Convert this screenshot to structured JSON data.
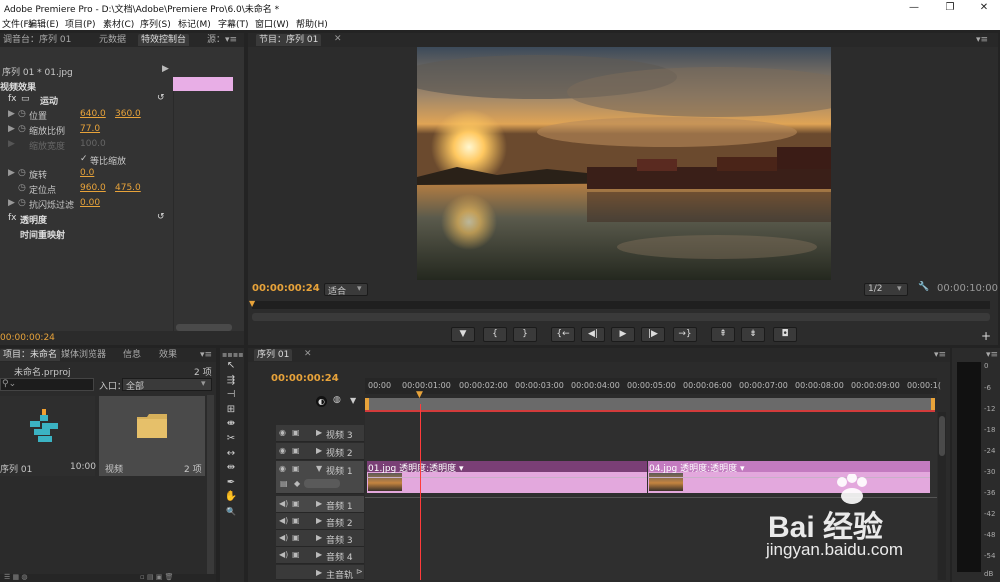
{
  "window": {
    "title": "Adobe Premiere Pro - D:\\文档\\Adobe\\Premiere Pro\\6.0\\未命名 *",
    "minimize": "—",
    "maximize": "❐",
    "close": "✕"
  },
  "menu": [
    "文件(F)",
    "编辑(E)",
    "项目(P)",
    "素材(C)",
    "序列(S)",
    "标记(M)",
    "字幕(T)",
    "窗口(W)",
    "帮助(H)"
  ],
  "effect_controls": {
    "tabs": [
      "调音台：序列 01",
      "元数据",
      "特效控制台",
      "源："
    ],
    "clip_label": "序列 01 * 01.jpg",
    "section": "视频效果",
    "motion": "运动",
    "position_label": "位置",
    "position_x": "640.0",
    "position_y": "360.0",
    "scale_label": "缩放比例",
    "scale": "77.0",
    "scale_width_label": "缩放宽度",
    "scale_width": "100.0",
    "uniform_label": "等比缩放",
    "rotation_label": "旋转",
    "rotation": "0.0",
    "anchor_label": "定位点",
    "anchor_x": "960.0",
    "anchor_y": "475.0",
    "flicker_label": "抗闪烁过滤",
    "flicker": "0.00",
    "opacity": "透明度",
    "time_remap": "时间重映射",
    "timecode": "00:00:00:24"
  },
  "program": {
    "tab": "节目：序列 01",
    "timecode": "00:00:00:24",
    "fit": "适合",
    "resolution": "1/2",
    "duration": "00:00:10:00",
    "buttons": [
      "▼",
      "{",
      "}",
      "{←",
      "◀|",
      "▶",
      "|▶",
      "→}",
      "⇞",
      "⇟",
      "◘"
    ],
    "plus": "+"
  },
  "project": {
    "tabs": [
      "项目：未命名",
      "媒体浏览器",
      "信息",
      "效果"
    ],
    "project_name": "未命名.prproj",
    "item_count": "2 项",
    "inpoint_label": "入口：",
    "inpoint_value": "全部",
    "items": [
      {
        "name": "序列 01",
        "meta": "10:00"
      },
      {
        "name": "视频",
        "meta": "2 项"
      }
    ]
  },
  "timeline": {
    "tab": "序列 01",
    "timecode": "00:00:00:24",
    "ruler": [
      "00:00",
      "00:00:01:00",
      "00:00:02:00",
      "00:00:03:00",
      "00:00:04:00",
      "00:00:05:00",
      "00:00:06:00",
      "00:00:07:00",
      "00:00:08:00",
      "00:00:09:00",
      "00:00:1("
    ],
    "video_tracks": [
      "视频 3",
      "视频 2",
      "视频 1"
    ],
    "audio_tracks": [
      "音频 1",
      "音频 2",
      "音频 3",
      "音频 4",
      "主音轨"
    ],
    "clips": [
      {
        "label": "01.jpg 透明度:透明度 ▾"
      },
      {
        "label": "04.jpg 透明度:透明度 ▾"
      }
    ]
  },
  "meter_scale": [
    "0",
    "-6",
    "-12",
    "-18",
    "-24",
    "-30",
    "-36",
    "-42",
    "-48",
    "-54",
    "dB"
  ],
  "tools": [
    "selection-tool",
    "track-select-tool",
    "ripple-edit-tool",
    "rolling-edit-tool",
    "rate-stretch-tool",
    "razor-tool",
    "slip-tool",
    "slide-tool",
    "pen-tool",
    "hand-tool",
    "zoom-tool"
  ],
  "tool_glyphs": [
    "↖",
    "⇶",
    "⊣",
    "⊞",
    "⇼",
    "✂",
    "↔",
    "⇹",
    "✒",
    "✋",
    "🔍"
  ],
  "watermark": {
    "brand": "Bai  经验",
    "url": "jingyan.baidu.com"
  },
  "colors": {
    "accent": "#e8a33a",
    "clip": "#e3a8dd",
    "clip_header": "#7a3f76",
    "playhead": "#ff3b3b"
  }
}
